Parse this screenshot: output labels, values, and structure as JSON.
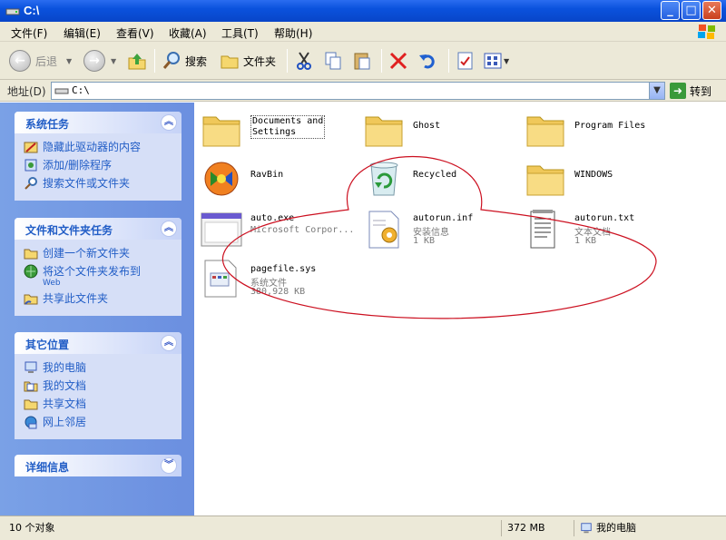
{
  "window": {
    "title": "C:\\"
  },
  "menu": [
    "文件(F)",
    "编辑(E)",
    "查看(V)",
    "收藏(A)",
    "工具(T)",
    "帮助(H)"
  ],
  "toolbar": {
    "back_label": "后退",
    "search_label": "搜索",
    "folders_label": "文件夹"
  },
  "address": {
    "label": "地址(D)",
    "value": "C:\\",
    "go_label": "转到"
  },
  "panels": {
    "system_tasks": {
      "title": "系统任务",
      "items": [
        "隐藏此驱动器的内容",
        "添加/删除程序",
        "搜索文件或文件夹"
      ]
    },
    "file_tasks": {
      "title": "文件和文件夹任务",
      "items": [
        "创建一个新文件夹",
        "将这个文件夹发布到",
        "共享此文件夹"
      ],
      "publish_sub": "Web"
    },
    "other_places": {
      "title": "其它位置",
      "items": [
        "我的电脑",
        "我的文档",
        "共享文档",
        "网上邻居"
      ]
    },
    "details": {
      "title": "详细信息"
    }
  },
  "files": [
    {
      "name_line1": "Documents and",
      "name_line2": "Settings",
      "type": "",
      "size": ""
    },
    {
      "name_line1": "Ghost",
      "type": "",
      "size": ""
    },
    {
      "name_line1": "Program Files",
      "type": "",
      "size": ""
    },
    {
      "name_line1": "RavBin",
      "type": "",
      "size": ""
    },
    {
      "name_line1": "Recycled",
      "type": "",
      "size": ""
    },
    {
      "name_line1": "WINDOWS",
      "type": "",
      "size": ""
    },
    {
      "name_line1": "auto.exe",
      "type": "Microsoft Corpor...",
      "size": ""
    },
    {
      "name_line1": "autorun.inf",
      "type": "安装信息",
      "size": "1 KB"
    },
    {
      "name_line1": "autorun.txt",
      "type": "文本文档",
      "size": "1 KB"
    },
    {
      "name_line1": "pagefile.sys",
      "type": "系统文件",
      "size": "380,928 KB"
    }
  ],
  "status": {
    "objects": "10 个对象",
    "size": "372 MB",
    "location": "我的电脑"
  },
  "colors": {
    "title_blue": "#0a52dd",
    "panel_blue": "#215dc6",
    "annotation_red": "#cc1020"
  }
}
